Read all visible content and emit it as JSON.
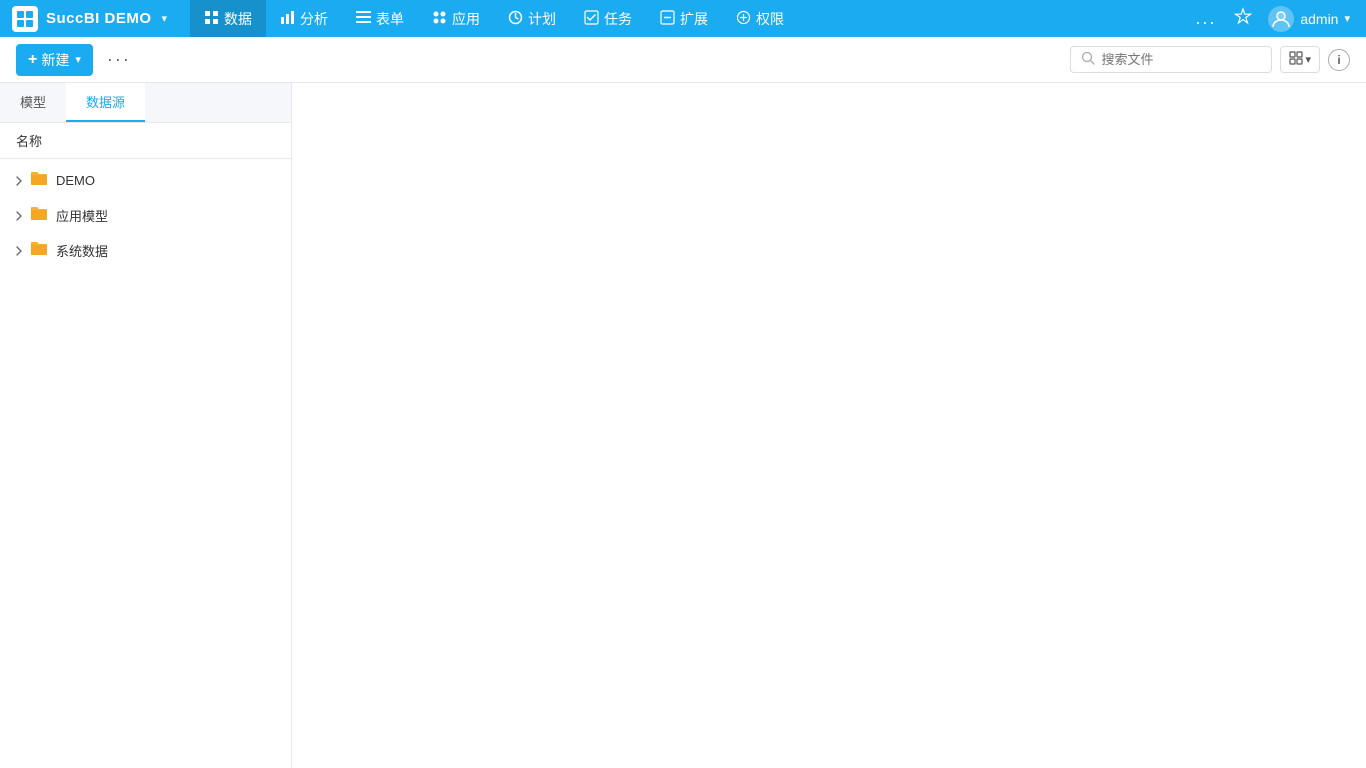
{
  "app": {
    "logo_text": "SuccBI DEMO",
    "logo_chevron": "▾"
  },
  "nav": {
    "items": [
      {
        "id": "data",
        "icon": "⊞",
        "label": "数据",
        "active": true
      },
      {
        "id": "analysis",
        "icon": "📊",
        "label": "分析",
        "active": false
      },
      {
        "id": "form",
        "icon": "☰",
        "label": "表单",
        "active": false
      },
      {
        "id": "app",
        "icon": "⚙",
        "label": "应用",
        "active": false
      },
      {
        "id": "plan",
        "icon": "🕐",
        "label": "计划",
        "active": false
      },
      {
        "id": "task",
        "icon": "☑",
        "label": "任务",
        "active": false
      },
      {
        "id": "expand",
        "icon": "⊟",
        "label": "扩展",
        "active": false
      },
      {
        "id": "rights",
        "icon": "⊕",
        "label": "权限",
        "active": false
      }
    ],
    "more_label": "...",
    "star_label": "☆",
    "user_name": "admin",
    "user_chevron": "▾"
  },
  "toolbar": {
    "new_label": "+ 新建",
    "more_label": "···",
    "search_placeholder": "搜索文件",
    "view_icon": "⊞",
    "view_chevron": "▾",
    "info_label": "i"
  },
  "sidebar": {
    "tabs": [
      {
        "id": "model",
        "label": "模型",
        "active": false
      },
      {
        "id": "datasource",
        "label": "数据源",
        "active": true
      }
    ],
    "col_header": "名称",
    "tree_items": [
      {
        "id": "demo",
        "label": "DEMO",
        "icon": "📁",
        "level": 0
      },
      {
        "id": "appmodel",
        "label": "应用模型",
        "icon": "📁",
        "level": 0
      },
      {
        "id": "sysdata",
        "label": "系统数据",
        "icon": "📁",
        "level": 0
      }
    ]
  }
}
